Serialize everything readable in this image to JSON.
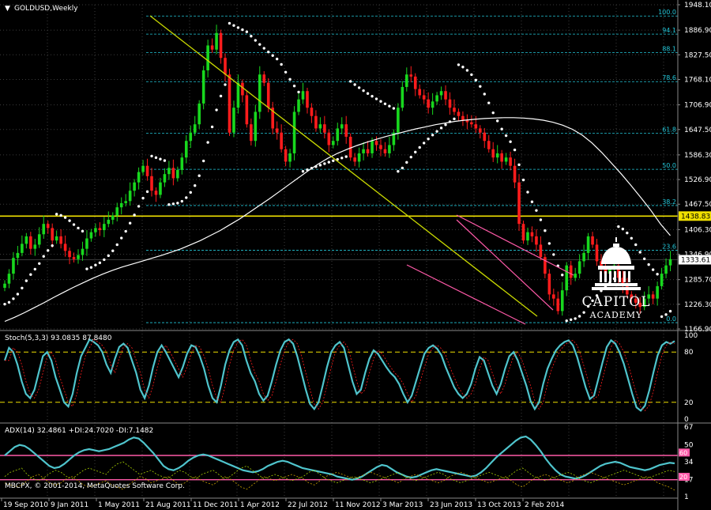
{
  "title": "GOLDUSD,Weekly",
  "colors": {
    "bull": "#18d81e",
    "bear": "#ff1c1c",
    "ma": "#ffffff",
    "sar": "#ffffff",
    "trend": "#c8d800",
    "channel": "#ff5aa8",
    "fib": "#22c6d8",
    "level": "#f0e000",
    "stoch": "#4fc4cc",
    "grid": "#3c3c3c"
  },
  "price_axis": [
    "1948.10",
    "1886.90",
    "1827.50",
    "1768.10",
    "1706.90",
    "1647.50",
    "1586.30",
    "1526.90",
    "1467.50",
    "1406.30",
    "1346.90",
    "1285.70",
    "1226.30",
    "1166.90"
  ],
  "fib_labels": [
    "100.0",
    "94.1",
    "88.1",
    "78.6",
    "61.8",
    "50.0",
    "38.2",
    "23.6",
    "0.0"
  ],
  "level_label": "1438.83",
  "current_label": "1333.61",
  "stoch": {
    "label": "Stoch(5,3,3) 93.0835 87.8480",
    "axis": [
      "100",
      "80",
      "20",
      "0"
    ]
  },
  "adx": {
    "label": "ADX(14) 32.4861 +DI:24.7020 -DI:7.1482",
    "axis": [
      "67",
      "50",
      "34",
      "17",
      "1"
    ],
    "badges": [
      "60",
      "20"
    ]
  },
  "copyright": "MBCPX, © 2001-2014, MetaQuotes Software Corp.",
  "dates": [
    "19 Sep 2010",
    "9 Jan 2011",
    "1 May 2011",
    "21 Aug 2011",
    "11 Dec 2011",
    "1 Apr 2012",
    "22 Jul 2012",
    "11 Nov 2012",
    "3 Mar 2013",
    "23 Jun 2013",
    "13 Oct 2013",
    "2 Feb 2014"
  ],
  "logo": {
    "line1": "CAPITOL",
    "line2": "ACADEMY"
  },
  "chart_data": [
    {
      "type": "candlestick",
      "title": "GOLDUSD,Weekly",
      "ylim": [
        1166.9,
        1948.1
      ],
      "x_start": "2010-09-19",
      "interval": "weekly",
      "close": [
        1276,
        1300,
        1338,
        1350,
        1372,
        1390,
        1360,
        1370,
        1395,
        1420,
        1410,
        1380,
        1390,
        1372,
        1355,
        1340,
        1335,
        1345,
        1360,
        1385,
        1400,
        1410,
        1405,
        1420,
        1430,
        1440,
        1460,
        1470,
        1475,
        1500,
        1520,
        1545,
        1560,
        1535,
        1500,
        1490,
        1520,
        1540,
        1555,
        1530,
        1550,
        1580,
        1620,
        1640,
        1660,
        1710,
        1790,
        1850,
        1840,
        1880,
        1820,
        1780,
        1640,
        1700,
        1760,
        1730,
        1660,
        1620,
        1690,
        1780,
        1760,
        1700,
        1650,
        1640,
        1600,
        1570,
        1590,
        1690,
        1720,
        1740,
        1700,
        1680,
        1650,
        1660,
        1640,
        1610,
        1620,
        1650,
        1660,
        1630,
        1580,
        1570,
        1590,
        1600,
        1590,
        1620,
        1610,
        1600,
        1590,
        1610,
        1640,
        1700,
        1750,
        1780,
        1775,
        1745,
        1730,
        1720,
        1700,
        1715,
        1730,
        1740,
        1720,
        1700,
        1690,
        1680,
        1670,
        1665,
        1660,
        1650,
        1640,
        1620,
        1600,
        1580,
        1590,
        1570,
        1580,
        1560,
        1520,
        1420,
        1380,
        1400,
        1390,
        1370,
        1340,
        1300,
        1250,
        1240,
        1210,
        1260,
        1320,
        1290,
        1300,
        1330,
        1350,
        1390,
        1370,
        1330,
        1310,
        1300,
        1310,
        1320,
        1290,
        1270,
        1250,
        1240,
        1230,
        1220,
        1240,
        1250,
        1240,
        1270,
        1300,
        1320,
        1335
      ],
      "series": [
        {
          "name": "MA",
          "values": [
            1185,
            1195,
            1206,
            1218,
            1230,
            1243,
            1255,
            1267,
            1278,
            1289,
            1299,
            1308,
            1316,
            1323,
            1330,
            1337,
            1344,
            1352,
            1360,
            1370,
            1380,
            1392,
            1404,
            1418,
            1432,
            1448,
            1464,
            1480,
            1497,
            1514,
            1531,
            1548,
            1564,
            1578,
            1590,
            1600,
            1609,
            1617,
            1624,
            1631,
            1637,
            1643,
            1649,
            1654,
            1659,
            1663,
            1667,
            1670,
            1672,
            1674,
            1675,
            1676,
            1676,
            1675,
            1673,
            1670,
            1665,
            1658,
            1648,
            1634,
            1615,
            1592,
            1566,
            1540,
            1512,
            1483,
            1453,
            1420,
            1392
          ]
        },
        {
          "name": "Fib",
          "levels": [
            "100.0",
            "94.1",
            "88.1",
            "78.6",
            "61.8",
            "50.0",
            "38.2",
            "23.6",
            "0.0"
          ]
        }
      ]
    },
    {
      "type": "line",
      "title": "Stoch(5,3,3) 93.0835 87.8480",
      "ylim": [
        0,
        100
      ],
      "series": [
        {
          "values": [
            70,
            85,
            80,
            65,
            45,
            30,
            25,
            35,
            55,
            75,
            80,
            70,
            50,
            35,
            20,
            15,
            30,
            55,
            75,
            85,
            95,
            92,
            88,
            80,
            65,
            55,
            72,
            86,
            90,
            85,
            70,
            55,
            35,
            25,
            40,
            62,
            80,
            88,
            80,
            70,
            60,
            50,
            62,
            78,
            88,
            86,
            75,
            60,
            40,
            25,
            20,
            40,
            65,
            82,
            92,
            95,
            88,
            70,
            55,
            45,
            30,
            22,
            28,
            45,
            65,
            82,
            92,
            95,
            90,
            75,
            55,
            35,
            18,
            12,
            20,
            40,
            62,
            80,
            88,
            92,
            85,
            65,
            45,
            30,
            35,
            55,
            72,
            82,
            78,
            70,
            62,
            55,
            50,
            42,
            30,
            20,
            28,
            45,
            62,
            78,
            85,
            88,
            84,
            76,
            62,
            50,
            38,
            30,
            25,
            30,
            42,
            60,
            74,
            70,
            55,
            40,
            30,
            42,
            60,
            75,
            80,
            70,
            55,
            40,
            22,
            12,
            20,
            42,
            60,
            72,
            82,
            88,
            92,
            94,
            88,
            74,
            56,
            38,
            24,
            28,
            48,
            68,
            86,
            94,
            90,
            80,
            66,
            48,
            30,
            14,
            10,
            16,
            34,
            56,
            76,
            88,
            92,
            90,
            93
          ]
        }
      ]
    },
    {
      "type": "line",
      "title": "ADX(14) 32.4861 +DI:24.7020 -DI:7.1482",
      "ylim": [
        1,
        67
      ],
      "series": [
        {
          "name": "ADX",
          "values": [
            40,
            44,
            48,
            50,
            49,
            46,
            42,
            38,
            34,
            30,
            28,
            29,
            32,
            36,
            40,
            43,
            45,
            46,
            45,
            44,
            45,
            46,
            48,
            50,
            52,
            55,
            57,
            56,
            52,
            47,
            42,
            36,
            30,
            27,
            26,
            28,
            31,
            35,
            38,
            40,
            41,
            40,
            38,
            36,
            34,
            32,
            30,
            28,
            26,
            25,
            24,
            25,
            27,
            30,
            32,
            34,
            35,
            34,
            32,
            30,
            28,
            27,
            26,
            25,
            24,
            23,
            22,
            20,
            19,
            18,
            17,
            18,
            20,
            23,
            26,
            29,
            31,
            30,
            27,
            24,
            22,
            20,
            19,
            20,
            22,
            24,
            26,
            27,
            26,
            25,
            24,
            23,
            22,
            21,
            20,
            21,
            24,
            28,
            33,
            38,
            42,
            46,
            50,
            54,
            57,
            58,
            55,
            50,
            44,
            37,
            31,
            26,
            22,
            20,
            19,
            18,
            19,
            21,
            24,
            27,
            30,
            32,
            33,
            34,
            33,
            31,
            29,
            28,
            27,
            26,
            27,
            29,
            31,
            32,
            33,
            32.5
          ]
        },
        {
          "name": "+DI",
          "values": [
            20,
            24,
            26,
            28,
            22,
            18,
            16,
            19,
            23,
            26,
            24,
            20,
            18,
            22,
            26,
            28,
            26,
            24,
            22,
            28,
            32,
            34,
            30,
            26,
            22,
            24,
            26,
            22,
            20,
            18,
            22,
            26,
            24,
            20,
            18,
            22,
            24,
            26,
            22,
            18,
            20,
            24,
            28,
            30,
            26,
            22,
            18,
            20,
            22,
            20,
            18,
            16,
            18,
            20,
            24,
            26,
            22,
            18,
            16,
            14,
            16,
            18,
            20,
            18,
            16,
            14,
            16,
            18,
            20,
            22,
            24,
            20,
            18,
            16,
            18,
            20,
            22,
            24,
            22,
            18,
            16,
            14,
            16,
            18,
            20,
            22,
            24,
            22,
            20,
            18,
            22,
            26,
            28,
            24,
            20,
            18,
            16,
            18,
            20,
            22,
            24,
            22,
            18,
            16,
            14,
            16,
            18,
            20,
            22,
            24,
            26,
            24,
            22,
            20,
            18,
            20,
            22,
            24,
            26,
            24.7
          ]
        },
        {
          "name": "-DI",
          "values": [
            14,
            12,
            10,
            12,
            16,
            20,
            22,
            18,
            14,
            12,
            14,
            18,
            20,
            16,
            12,
            10,
            12,
            14,
            16,
            12,
            10,
            8,
            12,
            16,
            20,
            18,
            14,
            16,
            18,
            20,
            16,
            12,
            14,
            18,
            20,
            16,
            14,
            12,
            16,
            20,
            18,
            14,
            10,
            8,
            12,
            16,
            20,
            18,
            16,
            18,
            20,
            22,
            20,
            18,
            14,
            12,
            16,
            20,
            22,
            24,
            22,
            20,
            18,
            20,
            22,
            24,
            22,
            20,
            18,
            16,
            14,
            18,
            20,
            22,
            20,
            18,
            16,
            14,
            16,
            20,
            22,
            24,
            22,
            20,
            18,
            16,
            14,
            16,
            18,
            20,
            16,
            12,
            10,
            14,
            18,
            20,
            22,
            20,
            18,
            16,
            14,
            16,
            20,
            22,
            24,
            22,
            20,
            18,
            16,
            14,
            12,
            14,
            16,
            18,
            20,
            18,
            14,
            12,
            10,
            7.1
          ]
        }
      ]
    }
  ]
}
